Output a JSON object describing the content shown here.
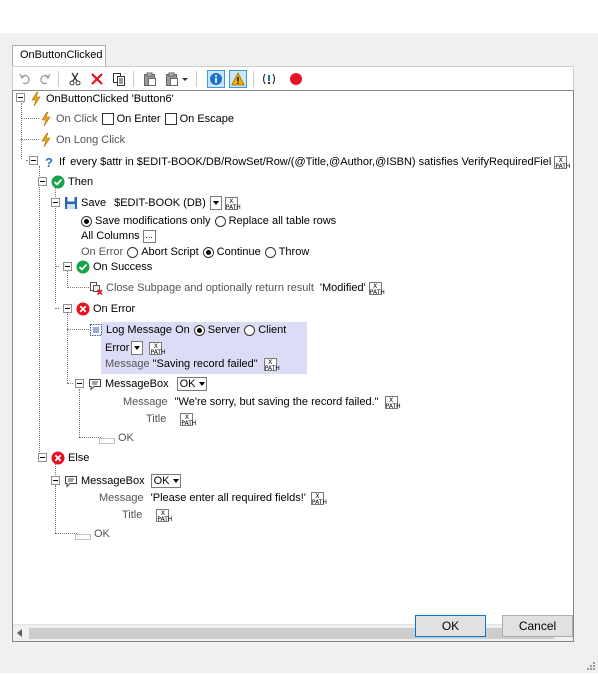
{
  "tab": {
    "label": "OnButtonClicked"
  },
  "toolbar": {
    "items": [
      "undo-icon",
      "redo-icon",
      "cut-icon",
      "delete-icon",
      "copy-icon",
      "paste-icon",
      "paste-special-icon",
      "info-icon",
      "warning-icon",
      "breakpoint-toggle-icon",
      "record-icon"
    ]
  },
  "colors": {
    "accent_blue": "#0078d7",
    "error_red": "#e81123",
    "success_green": "#16a34a",
    "event_orange": "#e8a317",
    "highlight": "#dcdcf6"
  },
  "tree": {
    "root": "OnButtonClicked 'Button6'",
    "on_click": "On Click",
    "on_enter": "On Enter",
    "on_escape": "On Escape",
    "on_long_click": "On Long Click",
    "if_label": "If",
    "if_expr": "every $attr in $EDIT-BOOK/DB/RowSet/Row/(@Title,@Author,@ISBN) satisfies VerifyRequiredFiel",
    "then": "Then",
    "save": {
      "label": "Save",
      "source": "$EDIT-BOOK (DB)",
      "opt_save_mods": "Save modifications only",
      "opt_replace": "Replace all table rows",
      "all_columns": "All Columns",
      "all_columns_btn": "...",
      "on_error": "On Error",
      "abort": "Abort Script",
      "continue": "Continue",
      "throw": "Throw"
    },
    "on_success": "On Success",
    "close_subpage": "Close Subpage and optionally return result",
    "close_subpage_value": "'Modified'",
    "on_error": "On Error",
    "log": {
      "label": "Log Message On",
      "server": "Server",
      "client": "Client",
      "level": "Error",
      "message_label": "Message",
      "message_value": "\"Saving record failed\""
    },
    "msgbox1": {
      "label": "MessageBox",
      "type": "OK",
      "message_label": "Message",
      "message_value": "\"We're sorry, but saving the record failed.\"",
      "title_label": "Title",
      "ok": "OK"
    },
    "else": "Else",
    "msgbox2": {
      "label": "MessageBox",
      "type": "OK",
      "message_label": "Message",
      "message_value": "'Please enter all required fields!'",
      "title_label": "Title",
      "ok": "OK"
    },
    "xpath_badge_top": "X",
    "xpath_badge_bottom": "PATH"
  },
  "buttons": {
    "ok": "OK",
    "cancel": "Cancel"
  }
}
